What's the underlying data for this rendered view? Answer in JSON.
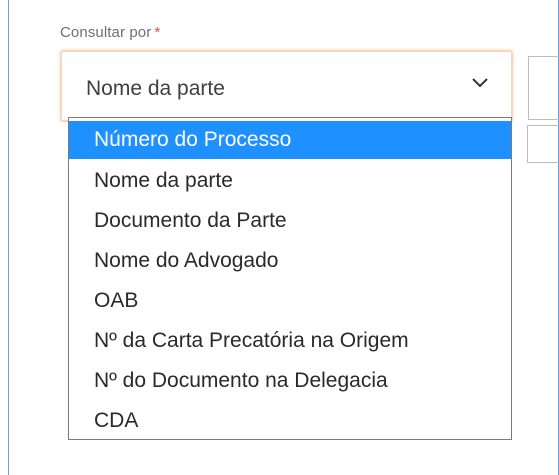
{
  "field": {
    "label": "Consultar por",
    "required_mark": "*",
    "selected_value": "Nome da parte"
  },
  "dropdown": {
    "options": [
      "Número do Processo",
      "Nome da parte",
      "Documento da Parte",
      "Nome do Advogado",
      "OAB",
      "Nº da Carta Precatória na Origem",
      "Nº do Documento na Delegacia",
      "CDA"
    ],
    "highlighted_index": 0
  },
  "colors": {
    "highlight": "#1e90ff",
    "required": "#d9534f",
    "focus_border": "#f6d8bf",
    "frame_border": "#6f9fd8"
  },
  "icons": {
    "select_arrow": "chevron-down-icon"
  }
}
